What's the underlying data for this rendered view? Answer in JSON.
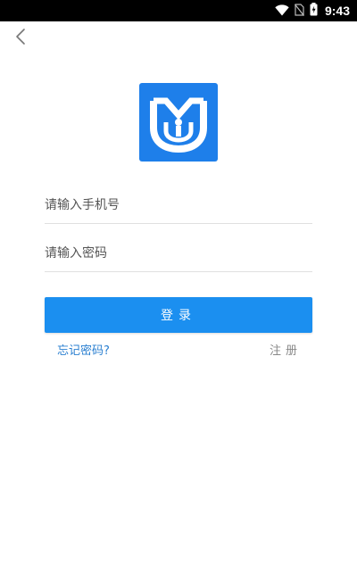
{
  "status_bar": {
    "time": "9:43",
    "icons": [
      "wifi-icon",
      "no-sim-icon",
      "battery-charging-icon"
    ]
  },
  "header": {
    "back_icon": "chevron-left-icon"
  },
  "logo": {
    "icon": "app-logo",
    "color": "#1e7fea"
  },
  "form": {
    "phone_placeholder": "请输入手机号",
    "password_placeholder": "请输入密码",
    "login_label": "登录",
    "forgot_label": "忘记密码?",
    "register_label": "注册"
  },
  "colors": {
    "accent": "#1b8ff0",
    "link": "#2a7fd0",
    "muted": "#888888"
  }
}
